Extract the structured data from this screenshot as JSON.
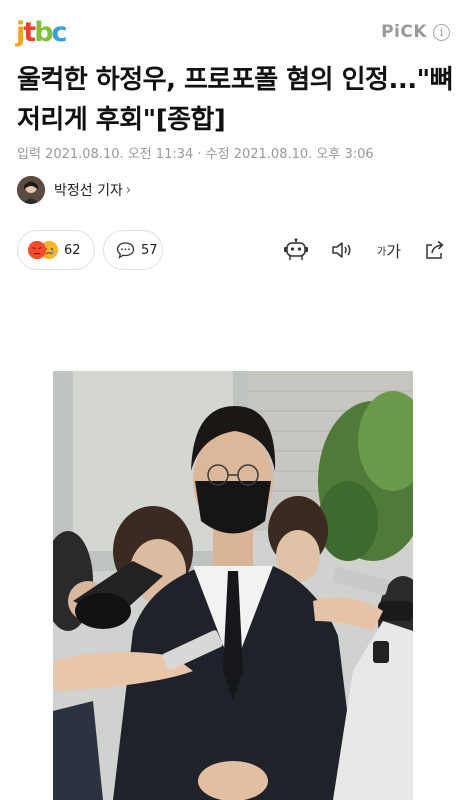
{
  "header": {
    "logo_letters": [
      {
        "ch": "j",
        "color": "#f5a31a"
      },
      {
        "ch": "t",
        "color": "#e8412c"
      },
      {
        "ch": "b",
        "color": "#7fbf3a"
      },
      {
        "ch": "c",
        "color": "#3aa0d8"
      }
    ],
    "pick_label": "PiCK",
    "info_icon": "info-icon"
  },
  "article": {
    "headline": "울컥한 하정우, 프로포폴 혐의 인정...\"뼈 저리게 후회\"[종합]",
    "meta": "입력 2021.08.10. 오전 11:34 · 수정 2021.08.10. 오후 3:06",
    "author": "박정선 기자",
    "author_chevron": "›"
  },
  "actions": {
    "reaction_count": "62",
    "comment_count": "57",
    "font_small": "가",
    "font_big": "가"
  },
  "colors": {
    "pill_border": "#e1e1e1",
    "meta_gray": "#999999"
  }
}
